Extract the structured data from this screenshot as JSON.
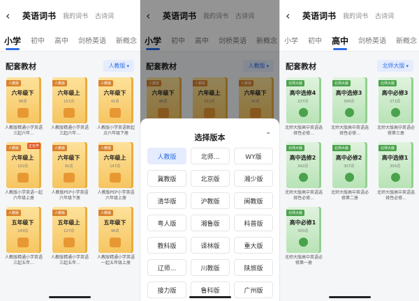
{
  "header": {
    "back_icon": "back-arrow-icon",
    "tabs": [
      {
        "label": "英语词书",
        "active": true
      },
      {
        "label": "我的词书",
        "active": false
      },
      {
        "label": "古诗词",
        "active": false
      }
    ]
  },
  "levels": [
    "小学",
    "初中",
    "高中",
    "剑桥英语",
    "新概念"
  ],
  "section_title": "配套教材",
  "colors": {
    "accent": "#2f6fe8",
    "orange_book": "#f6c561",
    "green_book": "#b8e3b6"
  },
  "screen1": {
    "version": "人教版",
    "books": [
      {
        "tag": "人教版",
        "badge": "",
        "title": "六年级下",
        "words": "86词",
        "caption": "人教版精通小学英语三起六年..."
      },
      {
        "tag": "人教版",
        "badge": "",
        "title": "六年级上",
        "words": "151词",
        "caption": "人教版精通小学英语三起六年..."
      },
      {
        "tag": "人教版",
        "badge": "",
        "title": "六年级下",
        "words": "41词",
        "caption": "人教版小学英语新起点六年级下册"
      },
      {
        "tag": "人教版",
        "badge": "正在学",
        "title": "六年级上",
        "words": "102词",
        "caption": "人教版小学英语一起六年级上册"
      },
      {
        "tag": "人教版",
        "badge": "",
        "title": "六年级下",
        "words": "91词",
        "caption": "人教版PEP小学英语六年级下册"
      },
      {
        "tag": "人教版",
        "badge": "",
        "title": "六年级上",
        "words": "147词",
        "caption": "人教版PEP小学英语六年级上册"
      },
      {
        "tag": "人教版",
        "badge": "",
        "title": "五年级下",
        "words": "143词",
        "caption": "人教版精通小学英语三起五年..."
      },
      {
        "tag": "人教版",
        "badge": "",
        "title": "五年级上",
        "words": "127词",
        "caption": "人教版精通小学英语三起五年..."
      },
      {
        "tag": "人教版",
        "badge": "",
        "title": "五年级下",
        "words": "96词",
        "caption": "人教版精通小学英语一起五年级上册"
      }
    ]
  },
  "screen2": {
    "version": "人教版",
    "sheet_title": "选择版本",
    "close_icon": "chevron-down-icon",
    "options": [
      {
        "label": "人教版",
        "selected": true
      },
      {
        "label": "北师...",
        "selected": false
      },
      {
        "label": "WY版",
        "selected": false
      },
      {
        "label": "冀教版",
        "selected": false
      },
      {
        "label": "北京版",
        "selected": false
      },
      {
        "label": "湘少版",
        "selected": false
      },
      {
        "label": "清华版",
        "selected": false
      },
      {
        "label": "沪教版",
        "selected": false
      },
      {
        "label": "闽教版",
        "selected": false
      },
      {
        "label": "粤人版",
        "selected": false
      },
      {
        "label": "湘鲁版",
        "selected": false
      },
      {
        "label": "科普版",
        "selected": false
      },
      {
        "label": "教科版",
        "selected": false
      },
      {
        "label": "译林版",
        "selected": false
      },
      {
        "label": "重大版",
        "selected": false
      },
      {
        "label": "辽师...",
        "selected": false
      },
      {
        "label": "川教版",
        "selected": false
      },
      {
        "label": "陕旅版",
        "selected": false
      },
      {
        "label": "接力版",
        "selected": false
      },
      {
        "label": "鲁科版",
        "selected": false
      },
      {
        "label": "广州版",
        "selected": false
      }
    ]
  },
  "screen3": {
    "version": "北师大版",
    "books": [
      {
        "tag": "北师大版",
        "badge": "",
        "title": "高中选修4",
        "words": "237词",
        "caption": "北师大版高中英语选择性必修..."
      },
      {
        "tag": "北师大版",
        "badge": "",
        "title": "高中选修3",
        "words": "306词",
        "caption": "北师大版高中英语选择性必修..."
      },
      {
        "tag": "北师大版",
        "badge": "",
        "title": "高中必修3",
        "words": "271词",
        "caption": "北师大版高中英语必修第三册"
      },
      {
        "tag": "北师大版",
        "badge": "",
        "title": "高中选修2",
        "words": "342词",
        "caption": "北师大版高中英语选择性必修..."
      },
      {
        "tag": "北师大版",
        "badge": "",
        "title": "高中必修2",
        "words": "307词",
        "caption": "北师大版高中英语必修第二册"
      },
      {
        "tag": "北师大版",
        "badge": "",
        "title": "高中选修1",
        "words": "305词",
        "caption": "北师大版高中英语选择性必修..."
      },
      {
        "tag": "北师大版",
        "badge": "",
        "title": "高中必修1",
        "words": "355词",
        "caption": "北师大版高中英语必修第一册"
      }
    ]
  }
}
